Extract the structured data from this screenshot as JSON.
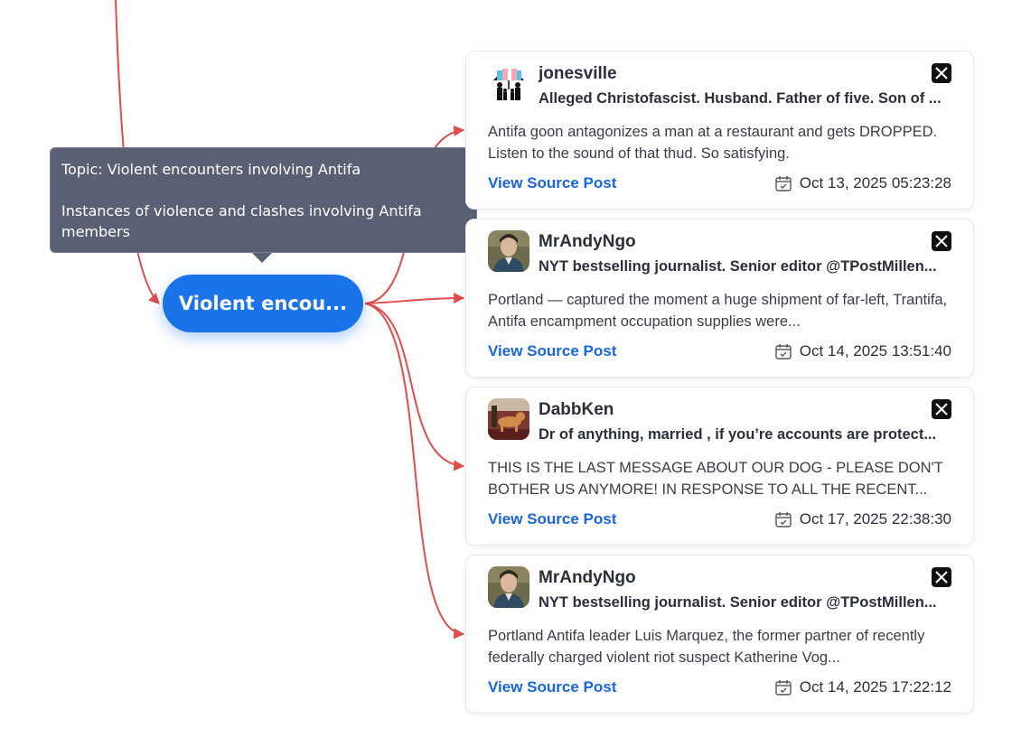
{
  "tooltip": {
    "topic_line": "Topic: Violent encounters involving Antifa",
    "description_line1": "Instances of violence and clashes involving Antifa",
    "description_line2": "members"
  },
  "topic_node": {
    "label": "Violent encou..."
  },
  "colors": {
    "edge": "#e04b4b",
    "node": "#1a73e8",
    "tooltip_bg": "#5b5f74",
    "link": "#1a66d9"
  },
  "posts": [
    {
      "username": "jonesville",
      "bio": "Alleged Christofascist. Husband. Father of five. Son of ...",
      "text": "Antifa goon antagonizes a man at a restaurant and gets DROPPED. Listen to the sound of that thud. So satisfying.",
      "link_label": "View Source Post",
      "date": "Oct 13, 2025 05:23:28",
      "avatar_icon": "family-umbrella-icon",
      "platform_icon": "x-logo-icon"
    },
    {
      "username": "MrAndyNgo",
      "bio": "NYT bestselling journalist. Senior editor @TPostMillen...",
      "text": "Portland — captured the moment a huge shipment of far-left, Trantifa, Antifa encampment occupation supplies were...",
      "link_label": "View Source Post",
      "date": "Oct 14, 2025 13:51:40",
      "avatar_icon": "portrait-avatar-icon",
      "platform_icon": "x-logo-icon"
    },
    {
      "username": "DabbKen",
      "bio": "Dr of anything, married , if you’re accounts are protect...",
      "text": "THIS IS THE LAST MESSAGE ABOUT OUR DOG - PLEASE DON'T BOTHER US ANYMORE! IN RESPONSE TO ALL THE RECENT...",
      "link_label": "View Source Post",
      "date": "Oct 17, 2025 22:38:30",
      "avatar_icon": "dog-photo-avatar-icon",
      "platform_icon": "x-logo-icon"
    },
    {
      "username": "MrAndyNgo",
      "bio": "NYT bestselling journalist. Senior editor @TPostMillen...",
      "text": "Portland Antifa leader Luis Marquez, the former partner of recently federally charged violent riot suspect Katherine Vog...",
      "link_label": "View Source Post",
      "date": "Oct 14, 2025 17:22:12",
      "avatar_icon": "portrait-avatar-icon",
      "platform_icon": "x-logo-icon"
    }
  ]
}
